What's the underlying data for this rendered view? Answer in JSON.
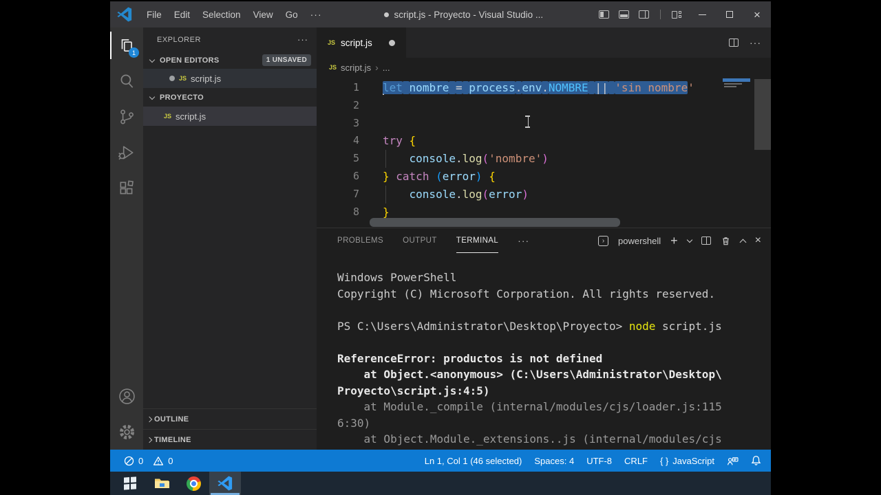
{
  "ui": {
    "ellipsis": "···"
  },
  "titlebar": {
    "menus": [
      "File",
      "Edit",
      "Selection",
      "View",
      "Go"
    ],
    "title": "script.js - Proyecto - Visual Studio ..."
  },
  "activity_bar": {
    "explorer_badge": "1"
  },
  "sidebar": {
    "title": "EXPLORER",
    "open_editors": {
      "label": "OPEN EDITORS",
      "badge": "1 UNSAVED",
      "file_icon": "JS",
      "file": "script.js"
    },
    "folder": {
      "label": "PROYECTO",
      "file_icon": "JS",
      "file": "script.js"
    },
    "outline_label": "OUTLINE",
    "timeline_label": "TIMELINE"
  },
  "editor": {
    "tab": {
      "file_icon": "JS",
      "file": "script.js"
    },
    "breadcrumb": {
      "file_icon": "JS",
      "file": "script.js",
      "sep": "›",
      "more": "..."
    },
    "lines": [
      {
        "num": "1",
        "cursor": true,
        "tokens": [
          {
            "t": "let",
            "c": "kw",
            "sel": true
          },
          {
            "t": " ",
            "c": "fg",
            "sel": true
          },
          {
            "t": "nombre",
            "c": "var",
            "sel": true
          },
          {
            "t": " ",
            "c": "fg",
            "sel": true
          },
          {
            "t": "=",
            "c": "op",
            "sel": true
          },
          {
            "t": " ",
            "c": "fg",
            "sel": true
          },
          {
            "t": "process",
            "c": "var",
            "sel": true
          },
          {
            "t": ".",
            "c": "fg",
            "sel": true
          },
          {
            "t": "env",
            "c": "var",
            "sel": true
          },
          {
            "t": ".",
            "c": "fg",
            "sel": true
          },
          {
            "t": "NOMBRE",
            "c": "const",
            "sel": true
          },
          {
            "t": " ",
            "c": "fg",
            "sel": true
          },
          {
            "t": "||",
            "c": "op",
            "sel": true
          },
          {
            "t": " ",
            "c": "fg",
            "sel": true
          },
          {
            "t": "'sin nombre",
            "c": "str",
            "sel": true
          },
          {
            "t": "'",
            "c": "str"
          }
        ]
      },
      {
        "num": "2",
        "tokens": []
      },
      {
        "num": "3",
        "tokens": []
      },
      {
        "num": "4",
        "tokens": [
          {
            "t": "try",
            "c": "kw2"
          },
          {
            "t": " ",
            "c": "fg"
          },
          {
            "t": "{",
            "c": "brace1"
          }
        ]
      },
      {
        "num": "5",
        "guide": true,
        "tokens": [
          {
            "t": "    ",
            "c": "fg"
          },
          {
            "t": "console",
            "c": "var"
          },
          {
            "t": ".",
            "c": "fg"
          },
          {
            "t": "log",
            "c": "fn"
          },
          {
            "t": "(",
            "c": "paren2"
          },
          {
            "t": "'nombre'",
            "c": "str"
          },
          {
            "t": ")",
            "c": "paren2"
          }
        ]
      },
      {
        "num": "6",
        "tokens": [
          {
            "t": "}",
            "c": "brace1"
          },
          {
            "t": " ",
            "c": "fg"
          },
          {
            "t": "catch",
            "c": "kw2"
          },
          {
            "t": " ",
            "c": "fg"
          },
          {
            "t": "(",
            "c": "paren3"
          },
          {
            "t": "error",
            "c": "var"
          },
          {
            "t": ")",
            "c": "paren3"
          },
          {
            "t": " ",
            "c": "fg"
          },
          {
            "t": "{",
            "c": "brace1"
          }
        ]
      },
      {
        "num": "7",
        "guide": true,
        "tokens": [
          {
            "t": "    ",
            "c": "fg"
          },
          {
            "t": "console",
            "c": "var"
          },
          {
            "t": ".",
            "c": "fg"
          },
          {
            "t": "log",
            "c": "fn"
          },
          {
            "t": "(",
            "c": "paren2"
          },
          {
            "t": "error",
            "c": "var"
          },
          {
            "t": ")",
            "c": "paren2"
          }
        ]
      },
      {
        "num": "8",
        "tokens": [
          {
            "t": "}",
            "c": "brace1"
          }
        ]
      }
    ]
  },
  "panel": {
    "tabs": [
      "PROBLEMS",
      "OUTPUT",
      "TERMINAL"
    ],
    "active_tab": "TERMINAL",
    "shell": "powershell"
  },
  "terminal": {
    "lines": [
      {
        "parts": [
          {
            "t": "Windows PowerShell",
            "c": "termfg"
          }
        ]
      },
      {
        "parts": [
          {
            "t": "Copyright (C) Microsoft Corporation. All rights reserved.",
            "c": "termfg"
          }
        ]
      },
      {
        "parts": []
      },
      {
        "parts": [
          {
            "t": "PS C:\\Users\\Administrator\\Desktop\\Proyecto> ",
            "c": "termfg"
          },
          {
            "t": "node",
            "c": "cmd"
          },
          {
            "t": " script.js",
            "c": "termfg"
          }
        ]
      },
      {
        "parts": []
      },
      {
        "parts": [
          {
            "t": "ReferenceError: productos is not defined",
            "c": "termbright"
          }
        ]
      },
      {
        "parts": [
          {
            "t": "    at Object.<anonymous> (C:\\Users\\Administrator\\Desktop\\",
            "c": "termbright"
          }
        ]
      },
      {
        "parts": [
          {
            "t": "Proyecto\\script.js:4:5)",
            "c": "termbright"
          }
        ]
      },
      {
        "parts": [
          {
            "t": "    at Module._compile (internal/modules/cjs/loader.js:115",
            "c": "termdim"
          }
        ]
      },
      {
        "parts": [
          {
            "t": "6:30)",
            "c": "termdim"
          }
        ]
      },
      {
        "parts": [
          {
            "t": "    at Object.Module._extensions..js (internal/modules/cjs",
            "c": "termdim"
          }
        ]
      }
    ]
  },
  "status_bar": {
    "errors": "0",
    "warnings": "0",
    "cursor_position": "Ln 1, Col 1 (46 selected)",
    "indentation": "Spaces: 4",
    "encoding": "UTF-8",
    "eol": "CRLF",
    "lang_braces": "{ }",
    "language": "JavaScript"
  },
  "colors": {
    "kw": "#569cd6",
    "kw2": "#c586c0",
    "var": "#9cdcfe",
    "const": "#4fc1ff",
    "op": "#d4d4d4",
    "fg": "#d4d4d4",
    "str": "#ce9178",
    "fn": "#dcdcaa",
    "brace1": "#ffd700",
    "paren2": "#da70d6",
    "paren3": "#179fff",
    "termfg": "#cccccc",
    "termdim": "#9a9a9a",
    "termbright": "#e9e9e9",
    "cmd": "#e5e510",
    "statusbar": "#0e7ad3",
    "selection": "#2e5c94"
  }
}
